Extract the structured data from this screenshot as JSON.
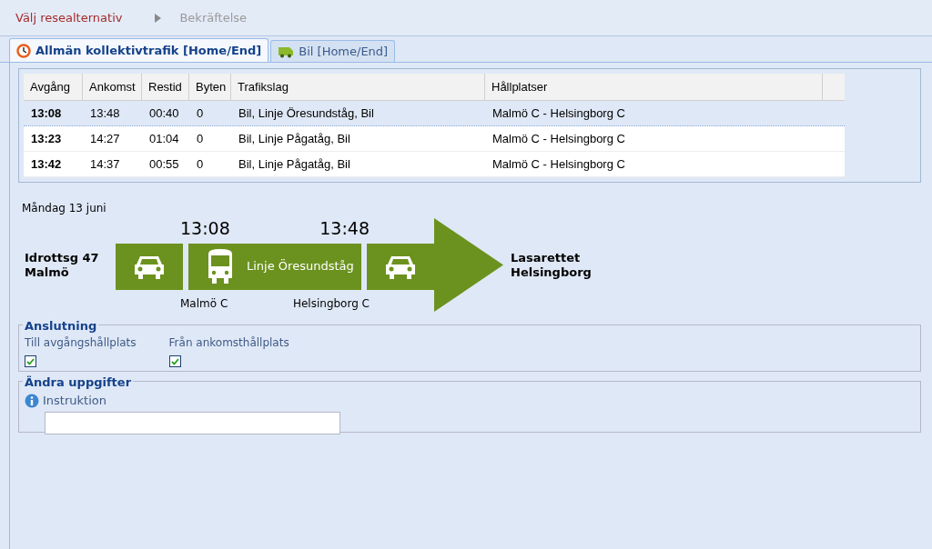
{
  "steps": [
    {
      "label": "Välj resealternativ",
      "selected": true
    },
    {
      "label": "Bekräftelse",
      "selected": false
    }
  ],
  "tabs": [
    {
      "label": "Allmän kollektivtrafik [Home/End]",
      "kind": "transit",
      "selected": true
    },
    {
      "label": "Bil [Home/End]",
      "kind": "car",
      "selected": false
    }
  ],
  "table": {
    "columns": [
      "Avgång",
      "Ankomst",
      "Restid",
      "Byten",
      "Trafikslag",
      "Hållplatser"
    ],
    "rows": [
      {
        "cells": [
          "13:08",
          "13:48",
          "00:40",
          "0",
          "Bil, Linje Öresundståg, Bil",
          "Malmö C - Helsingborg C"
        ],
        "selected": true
      },
      {
        "cells": [
          "13:23",
          "14:27",
          "01:04",
          "0",
          "Bil, Linje Pågatåg, Bil",
          "Malmö C - Helsingborg C"
        ],
        "selected": false
      },
      {
        "cells": [
          "13:42",
          "14:37",
          "00:55",
          "0",
          "Bil, Linje Pågatåg, Bil",
          "Malmö C - Helsingborg C"
        ],
        "selected": false
      }
    ]
  },
  "journey": {
    "date": "Måndag 13 juni",
    "origin": [
      "Idrottsg 47",
      "Malmö"
    ],
    "destination": [
      "Lasarettet",
      "Helsingborg"
    ],
    "segments": [
      {
        "kind": "car"
      },
      {
        "kind": "bus",
        "label": "Linje Öresundståg",
        "departure": "13:08",
        "arrival": "13:48",
        "from_stop": "Malmö C",
        "to_stop": "Helsingborg C"
      },
      {
        "kind": "car"
      }
    ]
  },
  "connection": {
    "title": "Anslutning",
    "options": [
      {
        "label": "Till avgångshållplats",
        "checked": true
      },
      {
        "label": "Från ankomsthållplats",
        "checked": true
      }
    ]
  },
  "details": {
    "title": "Ändra uppgifter",
    "field_label": "Instruktion"
  }
}
